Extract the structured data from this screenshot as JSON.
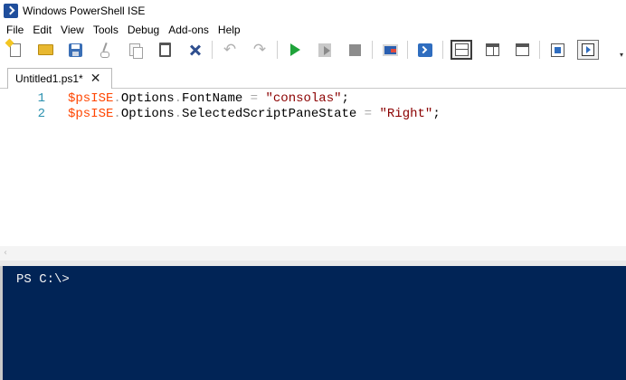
{
  "window": {
    "title": "Windows PowerShell ISE"
  },
  "menu": [
    "File",
    "Edit",
    "View",
    "Tools",
    "Debug",
    "Add-ons",
    "Help"
  ],
  "toolbar": {
    "buttons": [
      {
        "name": "new-script-button",
        "icon": "new-file-icon"
      },
      {
        "name": "open-button",
        "icon": "folder-icon"
      },
      {
        "name": "save-button",
        "icon": "save-icon"
      },
      {
        "name": "cut-button",
        "icon": "scissors-icon"
      },
      {
        "name": "copy-button",
        "icon": "copy-icon"
      },
      {
        "name": "paste-button",
        "icon": "clipboard-icon"
      },
      {
        "name": "clear-console-button",
        "icon": "clear-icon"
      },
      {
        "name": "undo-button",
        "icon": "undo-icon"
      },
      {
        "name": "redo-button",
        "icon": "redo-icon"
      },
      {
        "name": "run-script-button",
        "icon": "play-icon"
      },
      {
        "name": "run-selection-button",
        "icon": "run-selection-icon"
      },
      {
        "name": "stop-button",
        "icon": "stop-icon"
      },
      {
        "name": "new-remote-tab-button",
        "icon": "remote-icon"
      },
      {
        "name": "start-powershell-button",
        "icon": "powershell-icon"
      },
      {
        "name": "script-pane-top-button",
        "icon": "pane-top-icon"
      },
      {
        "name": "script-pane-right-button",
        "icon": "pane-right-icon"
      },
      {
        "name": "script-pane-maximized-button",
        "icon": "pane-max-icon"
      },
      {
        "name": "show-script-pane-button",
        "icon": "script-pane-icon"
      },
      {
        "name": "show-command-addon-button",
        "icon": "show-pane-icon"
      }
    ],
    "overflow_glyph": "▾"
  },
  "tab": {
    "label": "Untitled1.ps1*",
    "close_glyph": "✕"
  },
  "editor": {
    "lines": [
      {
        "number": "1",
        "tokens": [
          {
            "type": "var",
            "text": "$psISE"
          },
          {
            "type": "op",
            "text": "."
          },
          {
            "type": "prop",
            "text": "Options"
          },
          {
            "type": "op",
            "text": "."
          },
          {
            "type": "prop",
            "text": "FontName"
          },
          {
            "type": "op",
            "text": " = "
          },
          {
            "type": "str",
            "text": "\"consolas\""
          },
          {
            "type": "punc",
            "text": ";"
          }
        ]
      },
      {
        "number": "2",
        "tokens": [
          {
            "type": "var",
            "text": "$psISE"
          },
          {
            "type": "op",
            "text": "."
          },
          {
            "type": "prop",
            "text": "Options"
          },
          {
            "type": "op",
            "text": "."
          },
          {
            "type": "prop",
            "text": "SelectedScriptPaneState"
          },
          {
            "type": "op",
            "text": " = "
          },
          {
            "type": "str",
            "text": "\"Right\""
          },
          {
            "type": "punc",
            "text": ";"
          }
        ]
      }
    ],
    "scroll_left_glyph": "‹"
  },
  "console": {
    "prompt": "PS C:\\>"
  },
  "colors": {
    "console_bg": "#012456",
    "line_number": "#2b91af",
    "variable": "#ff4500",
    "string": "#8b0000",
    "operator": "#a9a9a9"
  }
}
